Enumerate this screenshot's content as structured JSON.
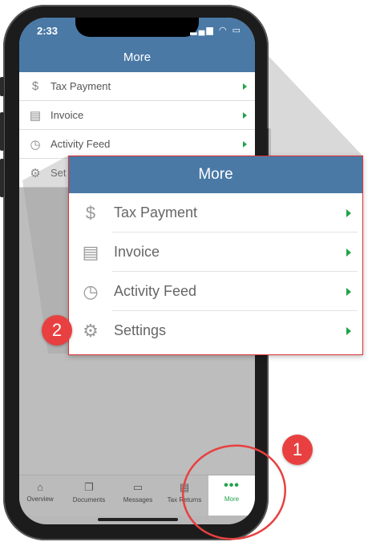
{
  "status": {
    "time": "2:33"
  },
  "header": {
    "title": "More"
  },
  "menu": {
    "items": [
      {
        "label": "Tax Payment",
        "icon": "dollar-icon"
      },
      {
        "label": "Invoice",
        "icon": "invoice-icon"
      },
      {
        "label": "Activity Feed",
        "icon": "clock-icon"
      },
      {
        "label": "Settings",
        "icon": "gear-icon"
      }
    ],
    "small_settings_label": "Set"
  },
  "callout": {
    "title": "More"
  },
  "tabs": [
    {
      "label": "Overview",
      "icon": "home-icon"
    },
    {
      "label": "Documents",
      "icon": "documents-icon"
    },
    {
      "label": "Messages",
      "icon": "messages-icon"
    },
    {
      "label": "Tax Returns",
      "icon": "tax-returns-icon"
    },
    {
      "label": "More",
      "icon": "more-icon"
    }
  ],
  "annotations": {
    "step1": "1",
    "step2": "2"
  },
  "colors": {
    "brand_blue": "#4a79a6",
    "accent_green": "#21a34a",
    "annotation_red": "#e84040"
  }
}
